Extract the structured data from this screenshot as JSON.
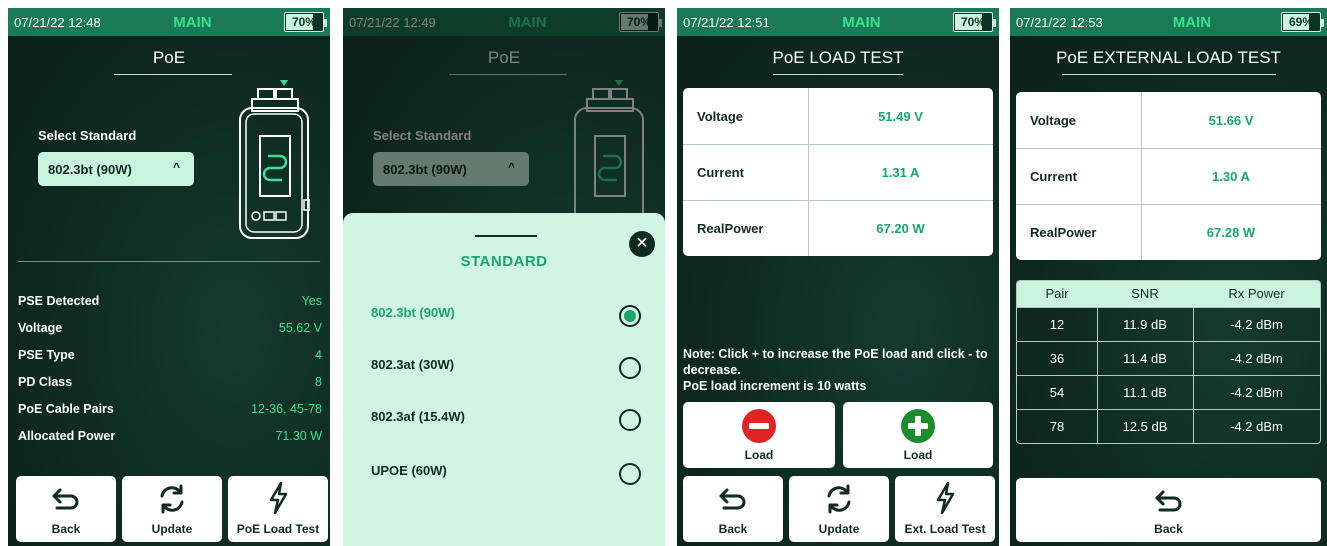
{
  "screens": [
    {
      "status": {
        "time": "07/21/22 12:48",
        "mode": "MAIN",
        "battery": "70%",
        "battery_level": 0.7
      },
      "title": "PoE",
      "select_label": "Select Standard",
      "dropdown_value": "802.3bt (90W)",
      "dropdown_chevron": "^",
      "info": [
        {
          "label": "PSE Detected",
          "value": "Yes"
        },
        {
          "label": "Voltage",
          "value": "55.62 V"
        },
        {
          "label": "PSE Type",
          "value": "4"
        },
        {
          "label": "PD Class",
          "value": "8"
        },
        {
          "label": "PoE Cable Pairs",
          "value": "12-36, 45-78"
        },
        {
          "label": "Allocated Power",
          "value": "71.30 W"
        }
      ],
      "buttons": {
        "back": "Back",
        "update": "Update",
        "load_test": "PoE Load Test"
      }
    },
    {
      "status": {
        "time": "07/21/22 12:49",
        "mode": "MAIN",
        "battery": "70%",
        "battery_level": 0.7
      },
      "title": "PoE",
      "select_label": "Select Standard",
      "dropdown_value": "802.3bt (90W)",
      "dropdown_chevron": "^",
      "sheet": {
        "title": "STANDARD",
        "close": "✕",
        "options": [
          {
            "label": "802.3bt (90W)",
            "selected": true
          },
          {
            "label": "802.3at (30W)",
            "selected": false
          },
          {
            "label": "802.3af (15.4W)",
            "selected": false
          },
          {
            "label": "UPOE (60W)",
            "selected": false
          }
        ]
      }
    },
    {
      "status": {
        "time": "07/21/22 12:51",
        "mode": "MAIN",
        "battery": "70%",
        "battery_level": 0.7
      },
      "title": "PoE LOAD TEST",
      "metrics": [
        {
          "label": "Voltage",
          "value": "51.49 V"
        },
        {
          "label": "Current",
          "value": "1.31 A"
        },
        {
          "label": "RealPower",
          "value": "67.20 W"
        }
      ],
      "note": "Note: Click + to increase the PoE load and click - to decrease.",
      "note2": "PoE load increment is 10 watts",
      "load_minus": "Load",
      "load_plus": "Load",
      "buttons": {
        "back": "Back",
        "update": "Update",
        "ext_load_test": "Ext. Load Test"
      }
    },
    {
      "status": {
        "time": "07/21/22 12:53",
        "mode": "MAIN",
        "battery": "69%",
        "battery_level": 0.69
      },
      "title": "PoE EXTERNAL LOAD TEST",
      "metrics": [
        {
          "label": "Voltage",
          "value": "51.66 V"
        },
        {
          "label": "Current",
          "value": "1.30 A"
        },
        {
          "label": "RealPower",
          "value": "67.28 W"
        }
      ],
      "table": {
        "headers": [
          "Pair",
          "SNR",
          "Rx Power"
        ],
        "rows": [
          [
            "12",
            "11.9 dB",
            "-4.2 dBm"
          ],
          [
            "36",
            "11.4 dB",
            "-4.2 dBm"
          ],
          [
            "54",
            "11.1 dB",
            "-4.2 dBm"
          ],
          [
            "78",
            "12.5 dB",
            "-4.2 dBm"
          ]
        ]
      },
      "buttons": {
        "back": "Back"
      }
    }
  ],
  "colors": {
    "accent": "#39e08f",
    "status_bar": "#1a7a55",
    "background": "#0e2a21",
    "pale_green": "#c9f3dc"
  }
}
